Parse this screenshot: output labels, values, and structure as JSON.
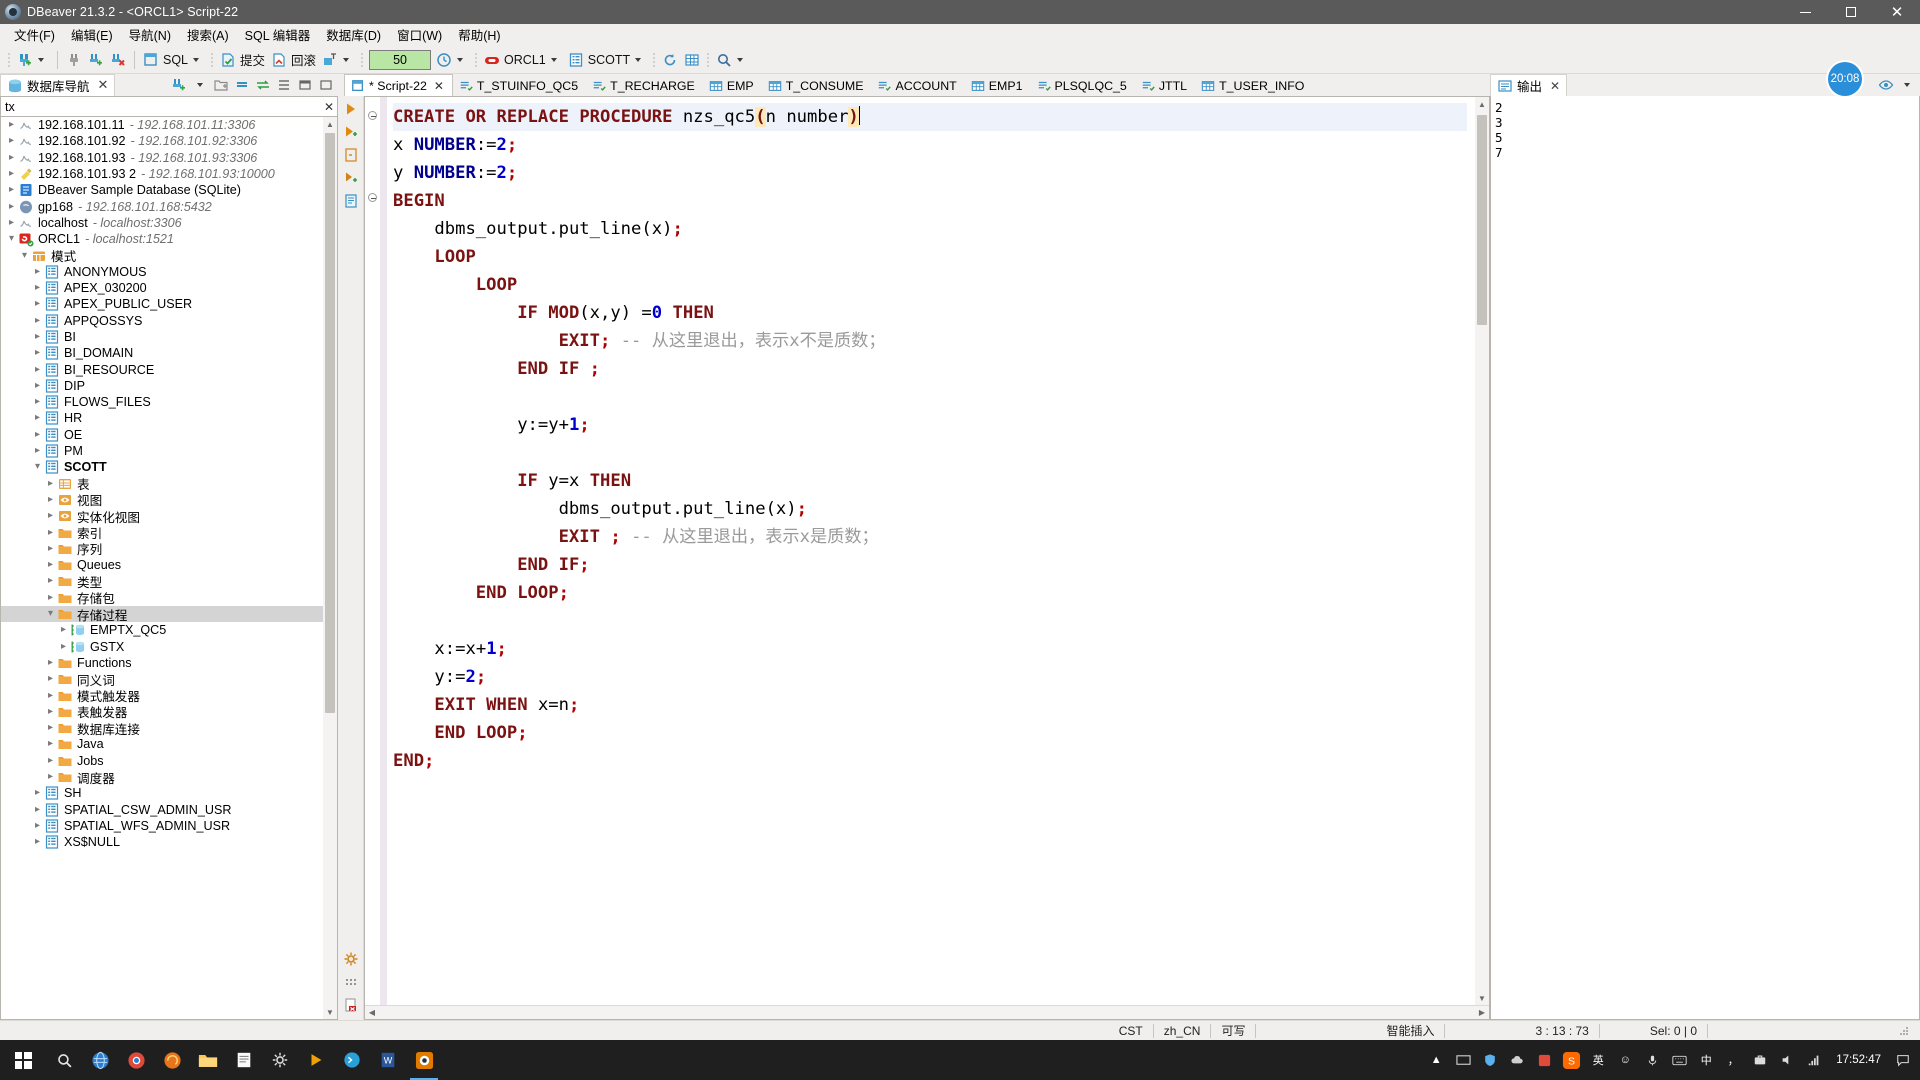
{
  "window": {
    "title": "DBeaver 21.3.2 - <ORCL1> Script-22",
    "minimize": "—",
    "maximize": "□",
    "close": "✕"
  },
  "menubar": {
    "items": [
      {
        "label": "文件(F)"
      },
      {
        "label": "编辑(E)"
      },
      {
        "label": "导航(N)"
      },
      {
        "label": "搜索(A)"
      },
      {
        "label": "SQL 编辑器"
      },
      {
        "label": "数据库(D)"
      },
      {
        "label": "窗口(W)"
      },
      {
        "label": "帮助(H)"
      }
    ]
  },
  "toolbar": {
    "sql_label": "SQL",
    "commit_label": "提交",
    "rollback_label": "回滚",
    "fetch_size": "50",
    "connection": "ORCL1",
    "schema": "SCOTT"
  },
  "sidebar": {
    "tab_label": "数据库导航",
    "tab_close": "✕",
    "filter": {
      "value": "tx",
      "placeholder": "",
      "clear": "✕"
    },
    "tree": [
      {
        "label": "192.168.101.11",
        "sub": "- 192.168.101.11:3306",
        "depth": 0,
        "twisty": "collapsed",
        "icon": "mysql-conn-icon"
      },
      {
        "label": "192.168.101.92",
        "sub": "- 192.168.101.92:3306",
        "depth": 0,
        "twisty": "collapsed",
        "icon": "mysql-conn-icon"
      },
      {
        "label": "192.168.101.93",
        "sub": "- 192.168.101.93:3306",
        "depth": 0,
        "twisty": "collapsed",
        "icon": "mysql-conn-icon"
      },
      {
        "label": "192.168.101.93 2",
        "sub": "- 192.168.101.93:10000",
        "depth": 0,
        "twisty": "collapsed",
        "icon": "hive-conn-icon"
      },
      {
        "label": "DBeaver Sample Database (SQLite)",
        "sub": "",
        "depth": 0,
        "twisty": "collapsed",
        "icon": "sqlite-conn-icon"
      },
      {
        "label": "gp168",
        "sub": "- 192.168.101.168:5432",
        "depth": 0,
        "twisty": "collapsed",
        "icon": "postgres-conn-icon"
      },
      {
        "label": "localhost",
        "sub": "- localhost:3306",
        "depth": 0,
        "twisty": "collapsed",
        "icon": "mysql-conn-icon"
      },
      {
        "label": "ORCL1",
        "sub": "- localhost:1521",
        "depth": 0,
        "twisty": "expanded",
        "icon": "oracle-conn-icon"
      },
      {
        "label": "模式",
        "sub": "",
        "depth": 1,
        "twisty": "expanded",
        "icon": "schema-folder-icon"
      },
      {
        "label": "ANONYMOUS",
        "sub": "",
        "depth": 2,
        "twisty": "collapsed",
        "icon": "schema-icon"
      },
      {
        "label": "APEX_030200",
        "sub": "",
        "depth": 2,
        "twisty": "collapsed",
        "icon": "schema-icon"
      },
      {
        "label": "APEX_PUBLIC_USER",
        "sub": "",
        "depth": 2,
        "twisty": "collapsed",
        "icon": "schema-icon"
      },
      {
        "label": "APPQOSSYS",
        "sub": "",
        "depth": 2,
        "twisty": "collapsed",
        "icon": "schema-icon"
      },
      {
        "label": "BI",
        "sub": "",
        "depth": 2,
        "twisty": "collapsed",
        "icon": "schema-icon"
      },
      {
        "label": "BI_DOMAIN",
        "sub": "",
        "depth": 2,
        "twisty": "collapsed",
        "icon": "schema-icon"
      },
      {
        "label": "BI_RESOURCE",
        "sub": "",
        "depth": 2,
        "twisty": "collapsed",
        "icon": "schema-icon"
      },
      {
        "label": "DIP",
        "sub": "",
        "depth": 2,
        "twisty": "collapsed",
        "icon": "schema-icon"
      },
      {
        "label": "FLOWS_FILES",
        "sub": "",
        "depth": 2,
        "twisty": "collapsed",
        "icon": "schema-icon"
      },
      {
        "label": "HR",
        "sub": "",
        "depth": 2,
        "twisty": "collapsed",
        "icon": "schema-icon"
      },
      {
        "label": "OE",
        "sub": "",
        "depth": 2,
        "twisty": "collapsed",
        "icon": "schema-icon"
      },
      {
        "label": "PM",
        "sub": "",
        "depth": 2,
        "twisty": "collapsed",
        "icon": "schema-icon"
      },
      {
        "label": "SCOTT",
        "sub": "",
        "depth": 2,
        "twisty": "expanded",
        "icon": "schema-icon",
        "bold": true
      },
      {
        "label": "表",
        "sub": "",
        "depth": 3,
        "twisty": "collapsed",
        "icon": "tables-folder-icon"
      },
      {
        "label": "视图",
        "sub": "",
        "depth": 3,
        "twisty": "collapsed",
        "icon": "views-folder-icon"
      },
      {
        "label": "实体化视图",
        "sub": "",
        "depth": 3,
        "twisty": "collapsed",
        "icon": "views-folder-icon"
      },
      {
        "label": "索引",
        "sub": "",
        "depth": 3,
        "twisty": "collapsed",
        "icon": "folder-icon"
      },
      {
        "label": "序列",
        "sub": "",
        "depth": 3,
        "twisty": "collapsed",
        "icon": "folder-icon"
      },
      {
        "label": "Queues",
        "sub": "",
        "depth": 3,
        "twisty": "collapsed",
        "icon": "folder-icon"
      },
      {
        "label": "类型",
        "sub": "",
        "depth": 3,
        "twisty": "collapsed",
        "icon": "folder-icon"
      },
      {
        "label": "存储包",
        "sub": "",
        "depth": 3,
        "twisty": "collapsed",
        "icon": "folder-icon"
      },
      {
        "label": "存储过程",
        "sub": "",
        "depth": 3,
        "twisty": "expanded",
        "icon": "folder-icon",
        "selected": true
      },
      {
        "label": "EMPTX_QC5",
        "sub": "",
        "depth": 4,
        "twisty": "collapsed",
        "icon": "procedure-icon"
      },
      {
        "label": "GSTX",
        "sub": "",
        "depth": 4,
        "twisty": "collapsed",
        "icon": "procedure-icon"
      },
      {
        "label": "Functions",
        "sub": "",
        "depth": 3,
        "twisty": "collapsed",
        "icon": "folder-icon"
      },
      {
        "label": "同义词",
        "sub": "",
        "depth": 3,
        "twisty": "collapsed",
        "icon": "folder-icon"
      },
      {
        "label": "模式触发器",
        "sub": "",
        "depth": 3,
        "twisty": "collapsed",
        "icon": "folder-icon"
      },
      {
        "label": "表触发器",
        "sub": "",
        "depth": 3,
        "twisty": "collapsed",
        "icon": "folder-icon"
      },
      {
        "label": "数据库连接",
        "sub": "",
        "depth": 3,
        "twisty": "collapsed",
        "icon": "folder-icon"
      },
      {
        "label": "Java",
        "sub": "",
        "depth": 3,
        "twisty": "collapsed",
        "icon": "folder-icon"
      },
      {
        "label": "Jobs",
        "sub": "",
        "depth": 3,
        "twisty": "collapsed",
        "icon": "folder-icon"
      },
      {
        "label": "调度器",
        "sub": "",
        "depth": 3,
        "twisty": "collapsed",
        "icon": "folder-icon"
      },
      {
        "label": "SH",
        "sub": "",
        "depth": 2,
        "twisty": "collapsed",
        "icon": "schema-icon"
      },
      {
        "label": "SPATIAL_CSW_ADMIN_USR",
        "sub": "",
        "depth": 2,
        "twisty": "collapsed",
        "icon": "schema-icon"
      },
      {
        "label": "SPATIAL_WFS_ADMIN_USR",
        "sub": "",
        "depth": 2,
        "twisty": "collapsed",
        "icon": "schema-icon"
      },
      {
        "label": "XS$NULL",
        "sub": "",
        "depth": 2,
        "twisty": "collapsed",
        "icon": "schema-icon"
      }
    ]
  },
  "editor": {
    "tabs": [
      {
        "label": "*<ORCL1> Script-22",
        "icon": "sql-editor-icon",
        "active": true,
        "close": "✕"
      },
      {
        "label": "T_STUINFO_QC5",
        "icon": "view-icon",
        "active": false
      },
      {
        "label": "T_RECHARGE",
        "icon": "view-icon",
        "active": false
      },
      {
        "label": "EMP",
        "icon": "table-icon",
        "active": false
      },
      {
        "label": "T_CONSUME",
        "icon": "table-icon",
        "active": false
      },
      {
        "label": "ACCOUNT",
        "icon": "view-icon",
        "active": false
      },
      {
        "label": "EMP1",
        "icon": "table-icon",
        "active": false
      },
      {
        "label": "PLSQLQC_5",
        "icon": "view-icon",
        "active": false
      },
      {
        "label": "JTTL",
        "icon": "view-icon",
        "active": false
      },
      {
        "label": "T_USER_INFO",
        "icon": "table-icon",
        "active": false
      }
    ],
    "code_lines": [
      "CREATE OR REPLACE PROCEDURE nzs_qc5(n number)",
      "x NUMBER:=2;",
      "y NUMBER:=2;",
      "BEGIN",
      "    dbms_output.put_line(x);",
      "    LOOP",
      "        LOOP",
      "            IF MOD(x,y) =0 THEN",
      "                EXIT; -- 从这里退出，表示x不是质数；",
      "            END IF ;",
      "",
      "            y:=y+1;",
      "",
      "            IF y=x THEN",
      "                dbms_output.put_line(x);",
      "                EXIT ; -- 从这里退出，表示x是质数；",
      "            END IF;",
      "        END LOOP;",
      "",
      "    x:=x+1;",
      "    y:=2;",
      "    EXIT WHEN x=n;",
      "    END LOOP;",
      "END;"
    ]
  },
  "output": {
    "tab_label": "输出",
    "tab_close": "✕",
    "lines": [
      "2",
      "3",
      "5",
      "7"
    ]
  },
  "notification": {
    "time": "20:08"
  },
  "statusbar": {
    "encoding": "CST",
    "locale": "zh_CN",
    "writable": "可写",
    "insert_mode": "智能插入",
    "position": "3 : 13 : 73",
    "selection": "Sel: 0 | 0"
  },
  "taskbar": {
    "clock_time": "17:52:47",
    "ime_lang": "英",
    "ime_mode": "中",
    "ime_punct": "，"
  },
  "colors": {
    "titlebar_bg": "#5a5a5a",
    "chrome_bg": "#f0efee",
    "keyword": "#7a1212",
    "datatype": "#00008f",
    "number": "#0000cd",
    "comment": "#9a9a9a",
    "semicolon": "#b00000",
    "fetch_box": "#b9e6a5",
    "accent": "#2a8fd8",
    "selection_row": "#d4d4d4"
  }
}
